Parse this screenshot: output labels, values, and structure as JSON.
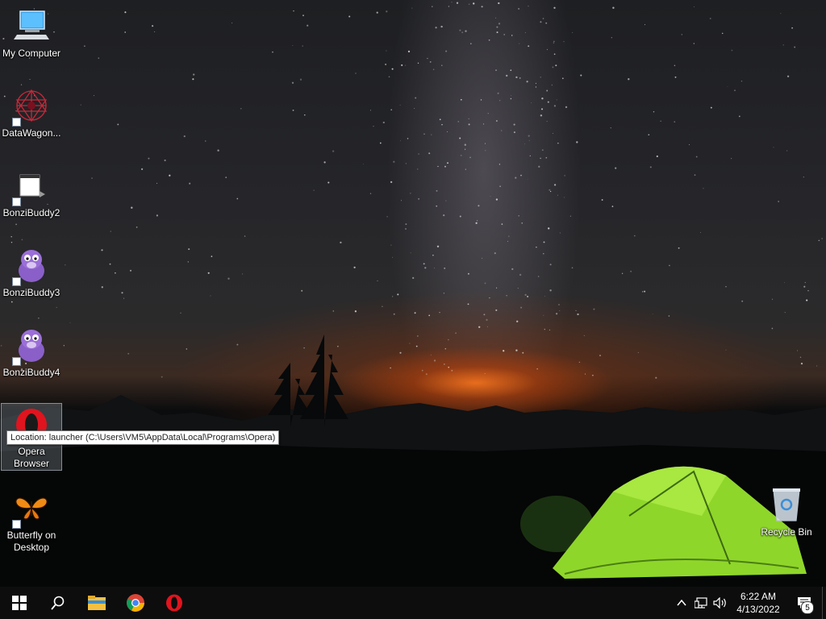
{
  "desktop_icons": [
    {
      "label": "My Computer",
      "icon": "computer-icon"
    },
    {
      "label": "DataWagon...",
      "icon": "datawagon-icon"
    },
    {
      "label": "BonziBuddy2",
      "icon": "folder-icon"
    },
    {
      "label": "BonziBuddy3",
      "icon": "bonzi-icon"
    },
    {
      "label": "BonziBuddy4",
      "icon": "bonzi-icon"
    },
    {
      "label": "Opera Browser",
      "icon": "opera-icon"
    },
    {
      "label": "Butterfly on Desktop",
      "icon": "butterfly-icon"
    },
    {
      "label": "Recycle Bin",
      "icon": "recycle-bin-icon"
    }
  ],
  "tooltip": {
    "text": "Location: launcher (C:\\Users\\VM5\\AppData\\Local\\Programs\\Opera)"
  },
  "taskbar": {
    "pinned": [
      "start-icon",
      "search-icon",
      "file-explorer-icon",
      "chrome-icon",
      "opera-icon"
    ],
    "clock": {
      "time": "6:22 AM",
      "date": "4/13/2022"
    },
    "notification_count": "5"
  },
  "colors": {
    "taskbar": "#0d0d0d",
    "tent": "#8fd62a",
    "opera_red": "#e0141e",
    "glow": "#ff7a1e"
  }
}
